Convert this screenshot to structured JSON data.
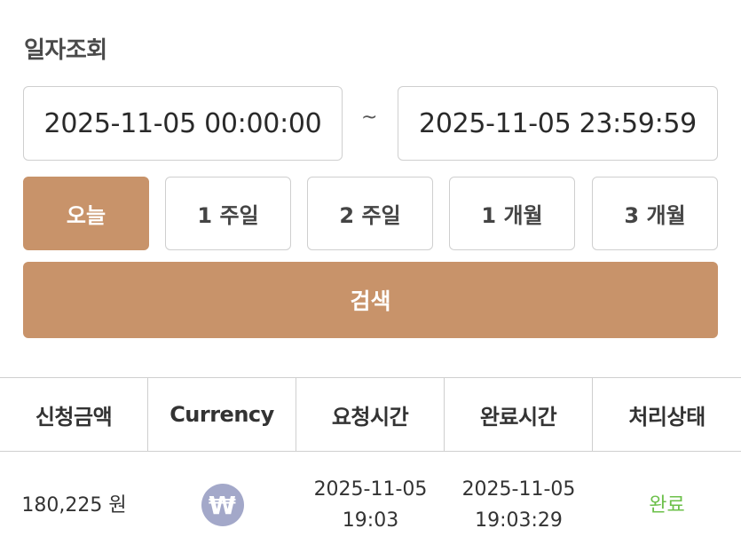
{
  "filter": {
    "title": "일자조회",
    "start_datetime": "2025-11-05 00:00:00",
    "separator": "~",
    "end_datetime": "2025-11-05 23:59:59",
    "ranges": [
      {
        "label": "오늘",
        "active": true
      },
      {
        "label": "1 주일",
        "active": false
      },
      {
        "label": "2 주일",
        "active": false
      },
      {
        "label": "1 개월",
        "active": false
      },
      {
        "label": "3 개월",
        "active": false
      }
    ],
    "search_label": "검색"
  },
  "table": {
    "headers": [
      "신청금액",
      "Currency",
      "요청시간",
      "완료시간",
      "처리상태"
    ],
    "rows": [
      {
        "amount": "180,225 원",
        "currency_icon": "won-icon",
        "currency_symbol": "₩",
        "requested_date": "2025-11-05",
        "requested_time": "19:03",
        "completed_date": "2025-11-05",
        "completed_time": "19:03:29",
        "status": "완료"
      }
    ]
  },
  "colors": {
    "accent": "#c8936a",
    "status_done": "#6cc04a",
    "currency_icon_bg": "#a3a8c9"
  }
}
